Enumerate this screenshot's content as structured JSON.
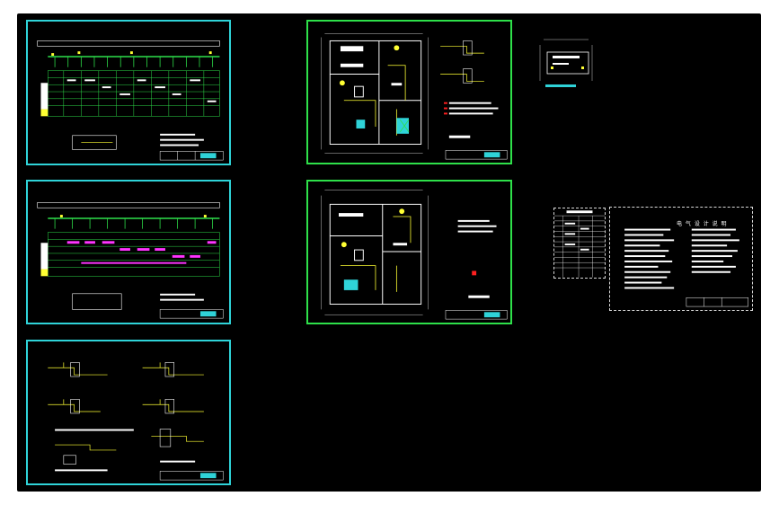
{
  "canvas": {
    "background": "#000000",
    "sheet_border": "#2fd3d8",
    "plan_border": "#2ee04a",
    "wire_color": "#ffff33",
    "accent_magenta": "#ff33ff",
    "accent_red": "#ff2020"
  },
  "sheets": {
    "distribution_top": {
      "title": ""
    },
    "distribution_mid": {
      "title": ""
    },
    "wiring_diagrams": {
      "title": ""
    },
    "floor_plan_1": {
      "title": ""
    },
    "floor_plan_2": {
      "title": ""
    },
    "symbol_legend": {
      "title": ""
    },
    "equipment_table": {
      "title": ""
    },
    "design_notes": {
      "title": "电 气 设 计 说 明"
    }
  }
}
